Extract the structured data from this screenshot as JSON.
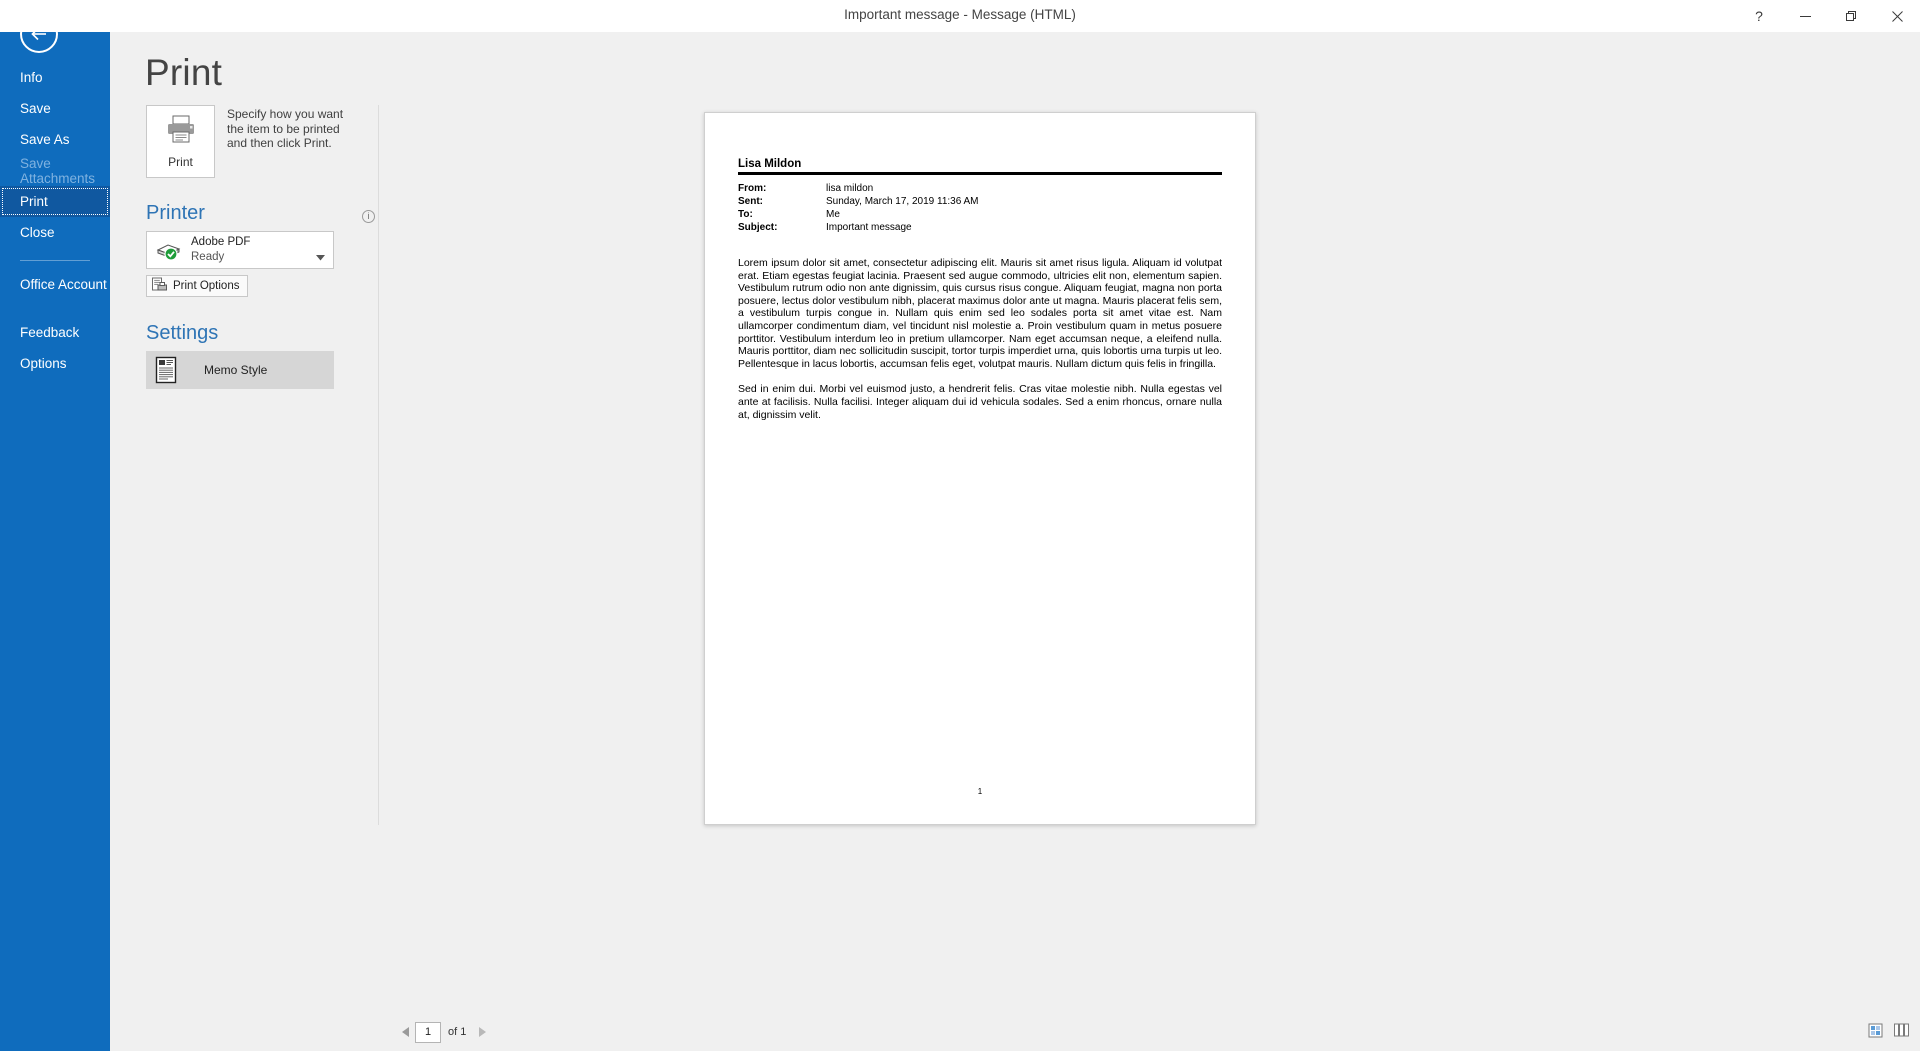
{
  "window": {
    "title": "Important message  -  Message (HTML)",
    "help_label": "?",
    "minimize_label": "Minimize",
    "restore_label": "Restore",
    "close_label": "Close"
  },
  "backstage": {
    "back_label": "Back",
    "page_title": "Print",
    "nav_items": [
      {
        "label": "Info",
        "state": "normal"
      },
      {
        "label": "Save",
        "state": "normal"
      },
      {
        "label": "Save As",
        "state": "normal"
      },
      {
        "label": "Save Attachments",
        "state": "disabled"
      },
      {
        "label": "Print",
        "state": "active"
      },
      {
        "label": "Close",
        "state": "normal"
      },
      {
        "label": "Office Account",
        "state": "normal"
      },
      {
        "label": "Feedback",
        "state": "normal"
      },
      {
        "label": "Options",
        "state": "normal"
      }
    ]
  },
  "print_panel": {
    "print_button_label": "Print",
    "print_help_text": "Specify how you want the item to be printed and then click Print.",
    "printer_section_title": "Printer",
    "printer_info_label": "i",
    "printer_name": "Adobe PDF",
    "printer_status": "Ready",
    "print_options_label": "Print Options",
    "settings_section_title": "Settings",
    "style_label": "Memo Style"
  },
  "preview": {
    "sender_name": "Lisa Mildon",
    "fields": [
      {
        "label": "From:",
        "value": "lisa mildon"
      },
      {
        "label": "Sent:",
        "value": "Sunday, March 17, 2019 11:36 AM"
      },
      {
        "label": "To:",
        "value": "Me"
      },
      {
        "label": "Subject:",
        "value": "Important message"
      }
    ],
    "paragraphs": [
      "Lorem ipsum dolor sit amet, consectetur adipiscing elit. Mauris sit amet risus ligula. Aliquam id volutpat erat. Etiam egestas feugiat lacinia. Praesent sed augue commodo, ultricies elit non, elementum sapien. Vestibulum rutrum odio non ante dignissim, quis cursus risus congue. Aliquam feugiat, magna non porta posuere, lectus dolor vestibulum nibh, placerat maximus dolor ante ut magna. Mauris placerat felis sem, a vestibulum turpis congue in. Nullam quis enim sed leo sodales porta sit amet vitae est. Nam ullamcorper condimentum diam, vel tincidunt nisl molestie a. Proin vestibulum quam in metus posuere porttitor. Vestibulum interdum leo in pretium ullamcorper. Nam eget accumsan neque, a eleifend nulla. Mauris porttitor, diam nec sollicitudin suscipit, tortor turpis imperdiet urna, quis lobortis urna turpis ut leo. Pellentesque in lacus lobortis, accumsan felis eget, volutpat mauris. Nullam dictum quis felis in fringilla.",
      "Sed in enim dui. Morbi vel euismod justo, a hendrerit felis. Cras vitae molestie nibh. Nulla egestas vel ante at facilisis. Nulla facilisi. Integer aliquam dui id vehicula sodales. Sed a enim rhoncus, ornare nulla at, dignissim velit."
    ],
    "page_number": "1"
  },
  "bottom_bar": {
    "prev_page_label": "Previous Page",
    "next_page_label": "Next Page",
    "current_page": "1",
    "page_count_label": "of 1",
    "zoom_tools": [
      "fit-page-icon",
      "multiple-pages-icon"
    ]
  },
  "colors": {
    "accent_blue": "#0f6cbd",
    "active_nav": "#1058a0",
    "section_heading": "#2e74b5",
    "selected_style": "#d6d6d6"
  }
}
